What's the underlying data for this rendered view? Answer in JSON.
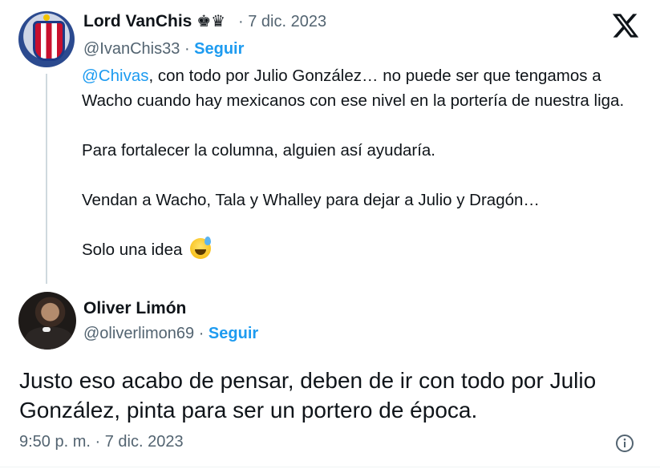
{
  "brand": {
    "logo": "x-logo-icon",
    "color": "#0f1419"
  },
  "colors": {
    "accent": "#1d9bf0",
    "muted": "#536471",
    "text": "#0f1419",
    "thread_line": "#cfd9de"
  },
  "tweet1": {
    "display_name": "Lord VanChis",
    "name_glyphs": "♚♛",
    "separator": "·",
    "date": "7 dic. 2023",
    "handle": "@IvanChis33",
    "follow_label": "Seguir",
    "mention": "@Chivas",
    "lines": {
      "p1_rest": ", con todo por Julio González… no puede ser que tengamos a Wacho cuando hay mexicanos con ese nivel en la portería de nuestra liga.",
      "p2": "Para fortalecer la columna, alguien así ayudaría.",
      "p3": "Vendan a Wacho, Tala y Whalley para dejar a Julio y Dragón…",
      "p4": "Solo una idea"
    },
    "emoji": "grinning-face-with-sweat-icon"
  },
  "tweet2": {
    "display_name": "Oliver Limón",
    "handle": "@oliverlimon69",
    "separator": "·",
    "follow_label": "Seguir",
    "text": "Justo eso acabo de pensar, deben de ir con todo por Julio González, pinta para ser un portero de época.",
    "timestamp": "9:50 p. m. · 7 dic. 2023"
  },
  "icons": {
    "info": "info-icon"
  }
}
